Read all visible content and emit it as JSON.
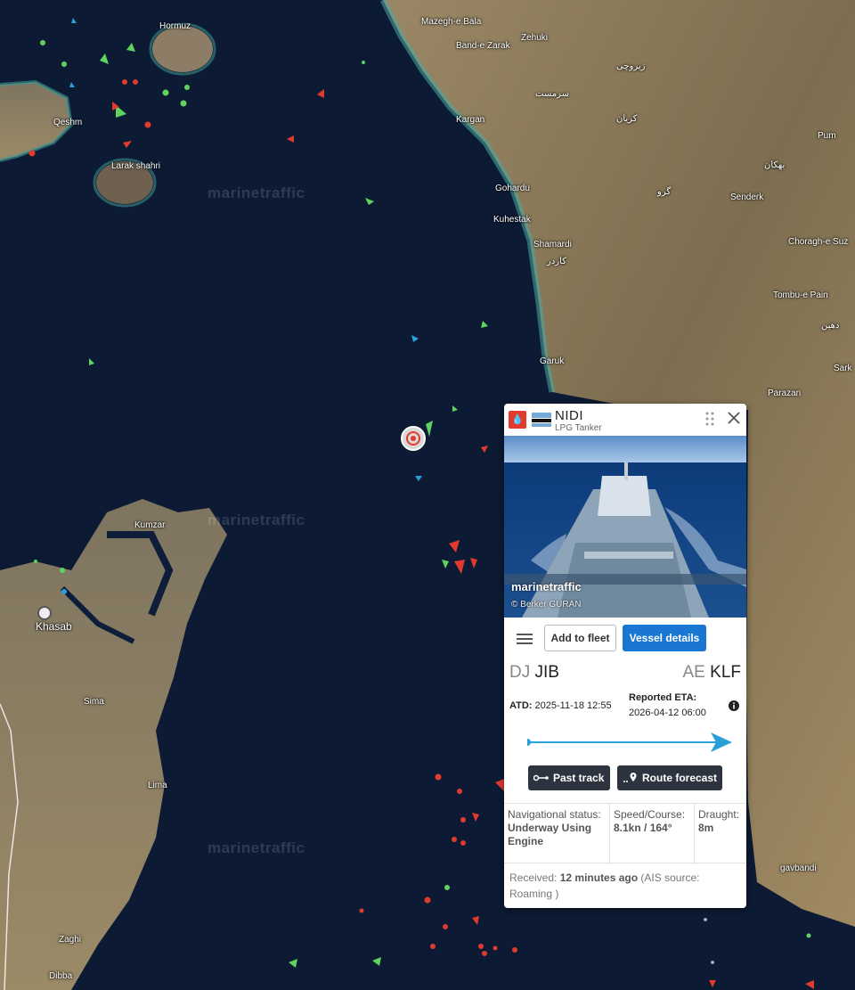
{
  "map": {
    "watermark": "marinetraffic",
    "places": [
      {
        "id": "hormuz",
        "label": "Hormuz"
      },
      {
        "id": "mazegh",
        "label": "Mazegh-e Bala"
      },
      {
        "id": "bandezarak",
        "label": "Band-e Zarak"
      },
      {
        "id": "zehuki",
        "label": "Zehuki"
      },
      {
        "id": "qeshm",
        "label": "Qeshm"
      },
      {
        "id": "larak",
        "label": "Larak shahri"
      },
      {
        "id": "kargan",
        "label": "Kargan"
      },
      {
        "id": "gohardu",
        "label": "Gohardu"
      },
      {
        "id": "kuhestak",
        "label": "Kuhestak"
      },
      {
        "id": "shamardi",
        "label": "Shamardi"
      },
      {
        "id": "garuk",
        "label": "Garuk"
      },
      {
        "id": "pum",
        "label": "Pum"
      },
      {
        "id": "senderk",
        "label": "Senderk"
      },
      {
        "id": "choragh",
        "label": "Choragh-e Suz"
      },
      {
        "id": "tombu",
        "label": "Tombu-e Pain"
      },
      {
        "id": "parazan",
        "label": "Parazan"
      },
      {
        "id": "sark",
        "label": "Sark"
      },
      {
        "id": "kumzar",
        "label": "Kumzar"
      },
      {
        "id": "khasab",
        "label": "Khasab"
      },
      {
        "id": "sima",
        "label": "Sima"
      },
      {
        "id": "lima",
        "label": "Lima"
      },
      {
        "id": "zaghi",
        "label": "Zaghi"
      },
      {
        "id": "dibba",
        "label": "Dibba"
      },
      {
        "id": "gavbandi",
        "label": "gavbandi"
      },
      {
        "id": "zirouchi",
        "label": "زیروچی"
      },
      {
        "id": "sarmast",
        "label": "سرمست"
      },
      {
        "id": "karian",
        "label": "کریان"
      },
      {
        "id": "goru",
        "label": "گرو"
      },
      {
        "id": "bahkan",
        "label": "بهکان"
      },
      {
        "id": "kardar",
        "label": "کاردر"
      },
      {
        "id": "dehin",
        "label": "دهین"
      }
    ]
  },
  "vessel": {
    "type_badge_icon": "lpg-tanker-icon",
    "flag": "Botswana",
    "name": "NIDI",
    "type": "LPG Tanker",
    "photo_watermark": "marinetraffic",
    "photo_credit": "© Berker GURAN",
    "add_to_fleet": "Add to fleet",
    "vessel_details": "Vessel details",
    "origin_cc": "DJ",
    "origin_port": "JIB",
    "dest_cc": "AE",
    "dest_port": "KLF",
    "atd_label": "ATD:",
    "atd_value": "2025-11-18 12:55",
    "eta_label": "Reported ETA:",
    "eta_value": "2026-04-12 06:00",
    "past_track": "Past track",
    "route_forecast": "Route forecast",
    "nav_status_label": "Navigational status:",
    "nav_status_value": "Underway Using Engine",
    "speed_label": "Speed/Course:",
    "speed_value": "8.1kn / 164°",
    "draught_label": "Draught:",
    "draught_value": "8m",
    "received_label": "Received:",
    "received_value": "12 minutes ago",
    "ais_source": "(AIS source: Roaming )"
  },
  "colors": {
    "sea": "#0d1b34",
    "land": "#8a7a5a",
    "accent": "#1976d2",
    "tanker": "#e23b2e",
    "cargo": "#5fd35f",
    "route": "#2aa0d8"
  }
}
